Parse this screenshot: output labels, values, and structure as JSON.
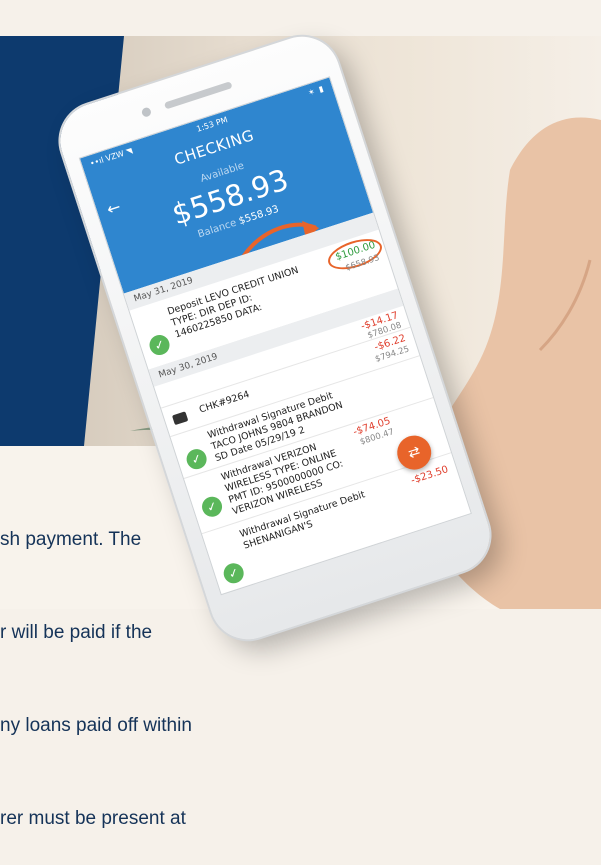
{
  "promo": {
    "lines": [
      "sh payment. The",
      "r will be paid if the",
      "ny loans paid off within",
      "rer must be present at"
    ]
  },
  "phone": {
    "status": {
      "carrier": "••ıl VZW ◥",
      "time": "1:53 PM",
      "icons": "✶ ▮"
    },
    "title": "CHECKING",
    "available_label": "Available",
    "available_amount": "$558.93",
    "balance_label": "Balance",
    "balance_amount": "$558.93",
    "sections": [
      {
        "date": "May 31, 2019",
        "transactions": [
          {
            "desc": "Deposit LEVO CREDIT UNION\nTYPE: DIR DEP ID:\n1460225850 DATA:",
            "amount": "$100.00",
            "running": "$658.93",
            "positive": true,
            "highlighted": true
          }
        ]
      },
      {
        "date": "May 30, 2019",
        "transactions": [
          {
            "desc": "",
            "amount": "-$14.17",
            "running": "$780.08",
            "positive": false
          },
          {
            "desc": "CHK#9264",
            "amount": "-$6.22",
            "running": "$794.25",
            "positive": false
          },
          {
            "desc": "Withdrawal Signature Debit\nTACO JOHNS 9804 BRANDON\nSD Date 05/29/19 2",
            "amount": "",
            "running": "",
            "positive": false
          },
          {
            "desc": "Withdrawal VERIZON\nWIRELESS TYPE: ONLINE\nPMT ID: 9500000000 CO:\nVERIZON WIRELESS",
            "amount": "-$74.05",
            "running": "$800.47",
            "positive": false
          },
          {
            "desc": "Withdrawal Signature Debit\nSHENANIGAN'S",
            "amount": "-$23.50",
            "running": "",
            "positive": false
          }
        ]
      }
    ],
    "fab_icon": "⇄"
  },
  "colors": {
    "header_blue": "#2f86cf",
    "navy": "#0d3a6e",
    "accent_orange": "#e8642a",
    "debit_red": "#e0402f",
    "credit_green": "#2e9b3d",
    "check_green": "#5bb75b"
  },
  "icons": {
    "back": "arrow-left-icon",
    "check": "check-circle-icon",
    "cheque": "cheque-icon",
    "transfer": "transfer-arrows-icon"
  }
}
